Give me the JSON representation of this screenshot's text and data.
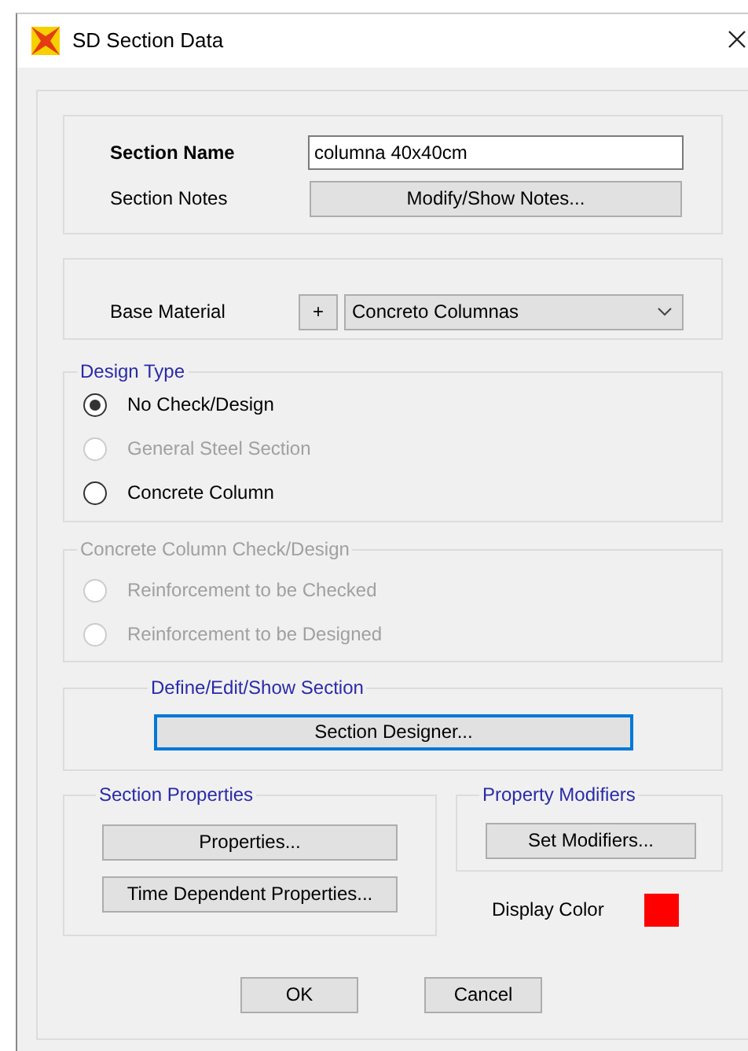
{
  "window": {
    "title": "SD Section Data"
  },
  "section": {
    "name_label": "Section Name",
    "name_value": "columna 40x40cm",
    "notes_label": "Section Notes",
    "notes_button": "Modify/Show Notes..."
  },
  "material": {
    "label": "Base Material",
    "add_button": "+",
    "value": "Concreto Columnas"
  },
  "design_type": {
    "legend": "Design Type",
    "disabled": false,
    "options": [
      {
        "label": "No Check/Design",
        "selected": true,
        "disabled": false
      },
      {
        "label": "General Steel Section",
        "selected": false,
        "disabled": true
      },
      {
        "label": "Concrete Column",
        "selected": false,
        "disabled": false
      }
    ]
  },
  "concrete_check": {
    "legend": "Concrete Column Check/Design",
    "disabled": true,
    "options": [
      {
        "label": "Reinforcement to be Checked",
        "selected": false,
        "disabled": true
      },
      {
        "label": "Reinforcement to be Designed",
        "selected": false,
        "disabled": true
      }
    ]
  },
  "define_section": {
    "legend": "Define/Edit/Show Section",
    "button": "Section Designer...",
    "focused": true
  },
  "section_properties": {
    "legend": "Section Properties",
    "buttons": [
      "Properties...",
      "Time Dependent Properties..."
    ]
  },
  "property_modifiers": {
    "legend": "Property Modifiers",
    "button": "Set Modifiers..."
  },
  "display_color": {
    "label": "Display Color",
    "color": "#ff0000"
  },
  "buttons": [
    "OK",
    "Cancel"
  ]
}
